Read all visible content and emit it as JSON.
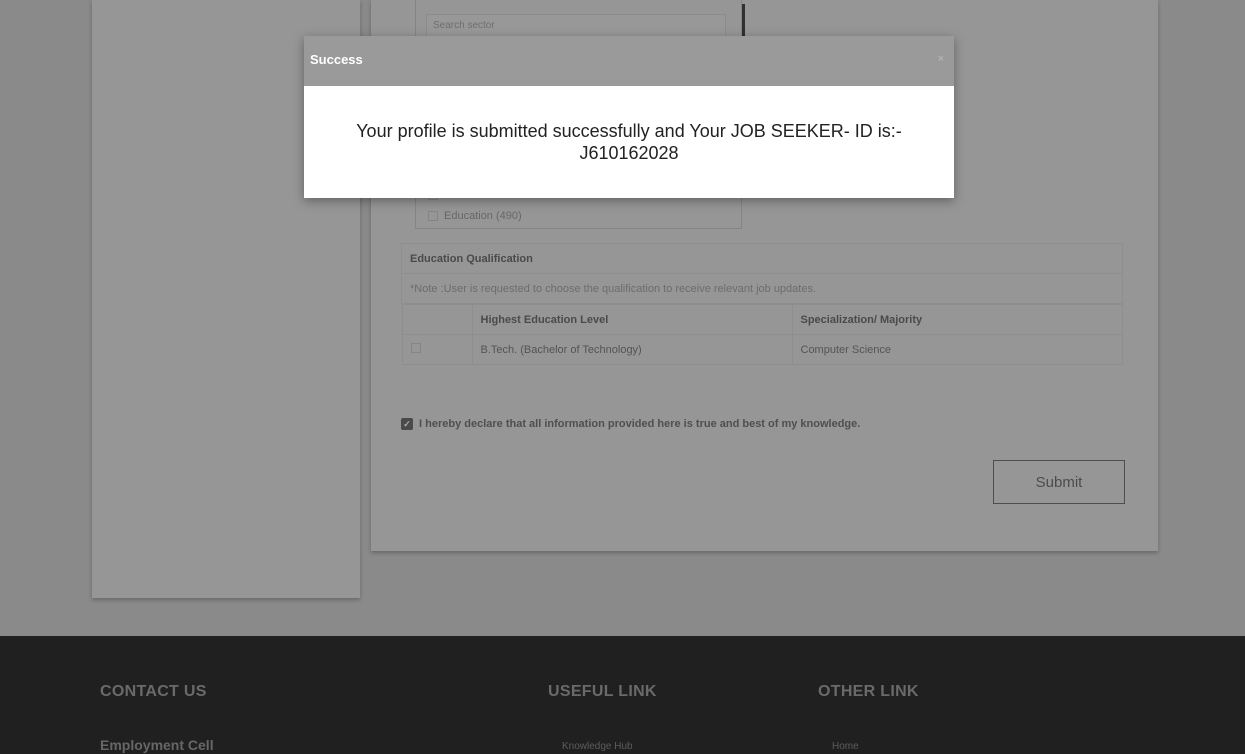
{
  "sector": {
    "search_placeholder": "Search sector",
    "items": [
      {
        "label": ""
      },
      {
        "label": "Education (490)"
      }
    ]
  },
  "education": {
    "heading": "Education Qualification",
    "note": "*Note :User is requested to choose the qualification to receive relevant job updates.",
    "columns": [
      "Highest Education Level",
      "Specialization/ Majority"
    ],
    "rows": [
      {
        "level": "B.Tech. (Bachelor of Technology)",
        "specialization": "Computer Science"
      }
    ]
  },
  "declaration": {
    "text": "I hereby declare that all information provided here is true and best of my knowledge.",
    "checked": true
  },
  "submit_label": "Submit",
  "modal": {
    "title": "Success",
    "close": "×",
    "message": "Your profile is submitted successfully and Your JOB SEEKER- ID is:- J610162028"
  },
  "footer": {
    "contact_heading": "CONTACT US",
    "contact_sub": "Employment Cell",
    "useful_heading": "USEFUL LINK",
    "useful_link": "Knowledge Hub",
    "other_heading": "OTHER LINK",
    "other_link": "Home"
  }
}
